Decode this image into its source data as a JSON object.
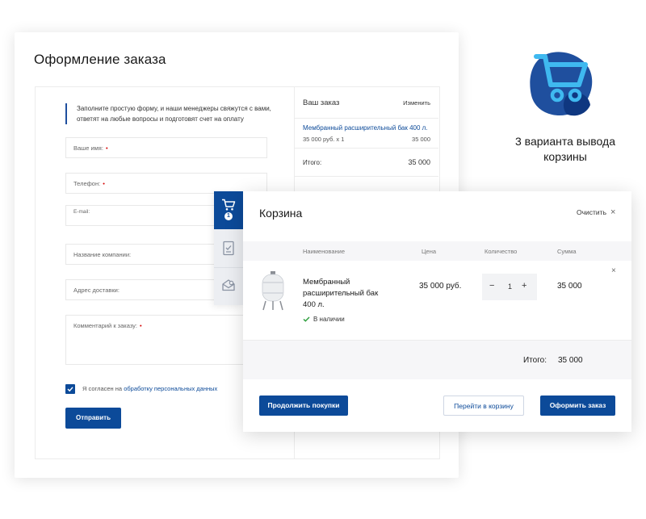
{
  "order": {
    "title": "Оформление заказа",
    "intro": "Заполните простую форму, и наши менеджеры свяжутся с вами, ответят на любые вопросы и подготовят счет на оплату",
    "fields": {
      "name": "Ваше имя:",
      "phone": "Телефон:",
      "email": "E-mail:",
      "company": "Название компании:",
      "address": "Адрес доставки:",
      "comment": "Комментарий к заказу:"
    },
    "required_mark": "•",
    "consent_prefix": "Я согласен на",
    "consent_link": "обработку персональных данных",
    "submit_label": "Отправить"
  },
  "summary": {
    "title": "Ваш заказ",
    "edit_label": "Изменить",
    "item_name": "Мембранный расширительный бак 400 л.",
    "item_qty": "35 000 руб. х 1",
    "item_price": "35 000",
    "total_label": "Итого:",
    "total_value": "35 000"
  },
  "side_tabs": {
    "badge": "1",
    "icons": [
      "cart-icon",
      "document-icon",
      "envelope-icon"
    ]
  },
  "cart": {
    "title": "Корзина",
    "clear_label": "Очистить",
    "headers": {
      "name": "Наименование",
      "price": "Цена",
      "qty": "Количество",
      "sum": "Сумма"
    },
    "item": {
      "name": "Мембранный расширительный бак 400 л.",
      "price": "35 000 руб.",
      "qty": "1",
      "qty_minus": "−",
      "qty_plus": "+",
      "sum": "35 000",
      "stock": "В наличии"
    },
    "total_label": "Итого:",
    "total_value": "35 000",
    "buttons": {
      "continue": "Продолжить покупки",
      "go_cart": "Перейти в корзину",
      "checkout": "Оформить заказ"
    },
    "close_glyph": "×"
  },
  "promo": {
    "text": "3 варианта вывода корзины"
  },
  "colors": {
    "brand": "#0c4a99",
    "required": "#d40000",
    "stock_ok": "#2a9d3a",
    "logo_blob": "#1f4f9e",
    "logo_cart": "#3fb9f0"
  }
}
